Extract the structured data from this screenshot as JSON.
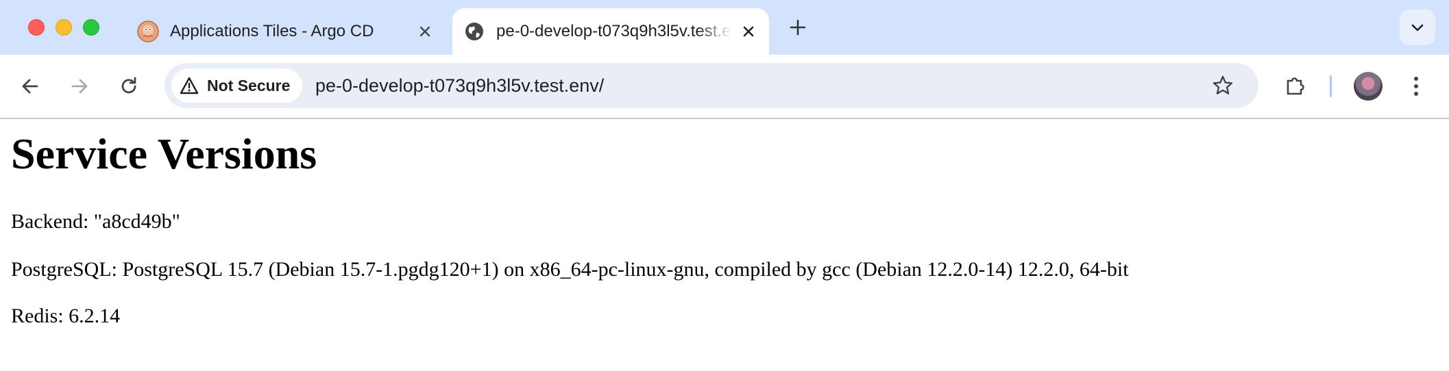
{
  "window": {
    "traffic_lights": [
      "close",
      "minimize",
      "zoom"
    ]
  },
  "tabs": [
    {
      "title": "Applications Tiles - Argo CD",
      "active": false,
      "favicon": "argo-octopus-icon"
    },
    {
      "title": "pe-0-develop-t073q9h3l5v.test.env/",
      "active": true,
      "favicon": "globe-icon"
    }
  ],
  "toolbar": {
    "security_chip": "Not Secure",
    "url": "pe-0-develop-t073q9h3l5v.test.env/"
  },
  "page": {
    "heading": "Service Versions",
    "lines": [
      "Backend: \"a8cd49b\"",
      "PostgreSQL: PostgreSQL 15.7 (Debian 15.7-1.pgdg120+1) on x86_64-pc-linux-gnu, compiled by gcc (Debian 12.2.0-14) 12.2.0, 64-bit",
      "Redis: 6.2.14"
    ]
  },
  "colors": {
    "tabstrip_bg": "#d3e3fd",
    "omnibox_bg": "#e9eef6",
    "text": "#1f1f1f"
  }
}
